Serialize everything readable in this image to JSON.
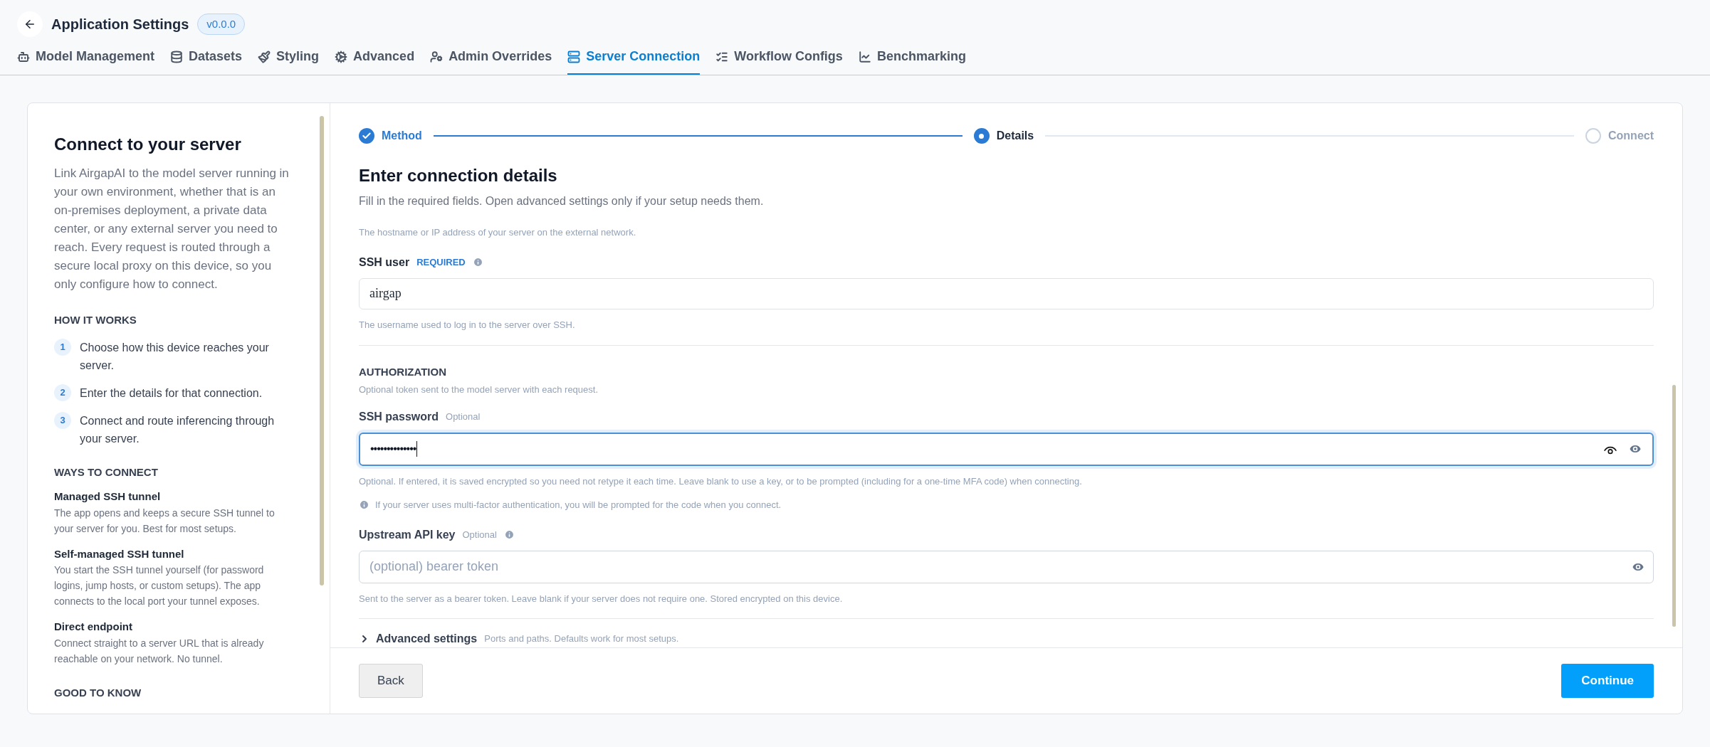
{
  "header": {
    "title": "Application Settings",
    "version": "v0.0.0"
  },
  "tabs": [
    {
      "label": "Model Management",
      "selected": false
    },
    {
      "label": "Datasets",
      "selected": false
    },
    {
      "label": "Styling",
      "selected": false
    },
    {
      "label": "Advanced",
      "selected": false
    },
    {
      "label": "Admin Overrides",
      "selected": false
    },
    {
      "label": "Server Connection",
      "selected": true
    },
    {
      "label": "Workflow Configs",
      "selected": false
    },
    {
      "label": "Benchmarking",
      "selected": false
    }
  ],
  "sidebar": {
    "title": "Connect to your server",
    "intro": "Link AirgapAI to the model server running in your own environment, whether that is an on-premises deployment, a private data center, or any external server you need to reach. Every request is routed through a secure local proxy on this device, so you only configure how to connect.",
    "how_heading": "HOW IT WORKS",
    "steps": [
      {
        "number": "1",
        "text": "Choose how this device reaches your server."
      },
      {
        "number": "2",
        "text": "Enter the details for that connection."
      },
      {
        "number": "3",
        "text": "Connect and route inferencing through your server."
      }
    ],
    "ways_heading": "WAYS TO CONNECT",
    "ways": [
      {
        "title": "Managed SSH tunnel",
        "text": "The app opens and keeps a secure SSH tunnel to your server for you. Best for most setups."
      },
      {
        "title": "Self-managed SSH tunnel",
        "text": "You start the SSH tunnel yourself (for password logins, jump hosts, or custom setups). The app connects to the local port your tunnel exposes."
      },
      {
        "title": "Direct endpoint",
        "text": "Connect straight to a server URL that is already reachable on your network. No tunnel."
      }
    ],
    "good_heading": "GOOD TO KNOW"
  },
  "stepper": [
    {
      "label": "Method",
      "completed": true,
      "current": false
    },
    {
      "label": "Details",
      "completed": false,
      "current": true
    },
    {
      "label": "Connect",
      "completed": false,
      "current": false
    }
  ],
  "form": {
    "title": "Enter connection details",
    "subtitle": "Fill in the required fields. Open advanced settings only if your setup needs them.",
    "top_hint": "The hostname or IP address of your server on the external network.",
    "ssh_user": {
      "label": "SSH user",
      "badge": "REQUIRED",
      "value": "airgap",
      "hint": "The username used to log in to the server over SSH."
    },
    "authorization": {
      "heading": "AUTHORIZATION",
      "subtitle": "Optional token sent to the model server with each request."
    },
    "ssh_password": {
      "label": "SSH password",
      "badge": "Optional",
      "value": "••••••••••••••",
      "focused": true,
      "hint": "Optional. If entered, it is saved encrypted so you need not retype it each time. Leave blank to use a key, or to be prompted (including for a one-time MFA code) when connecting.",
      "note": "If your server uses multi-factor authentication, you will be prompted for the code when you connect."
    },
    "api_key": {
      "label": "Upstream API key",
      "badge": "Optional",
      "placeholder": "(optional) bearer token",
      "hint": "Sent to the server as a bearer token. Leave blank if your server does not require one. Stored encrypted on this device."
    },
    "advanced": {
      "label": "Advanced settings",
      "note": "Ports and paths. Defaults work for most setups.",
      "expanded": false
    }
  },
  "buttons": {
    "back": "Back",
    "continue": "Continue"
  }
}
